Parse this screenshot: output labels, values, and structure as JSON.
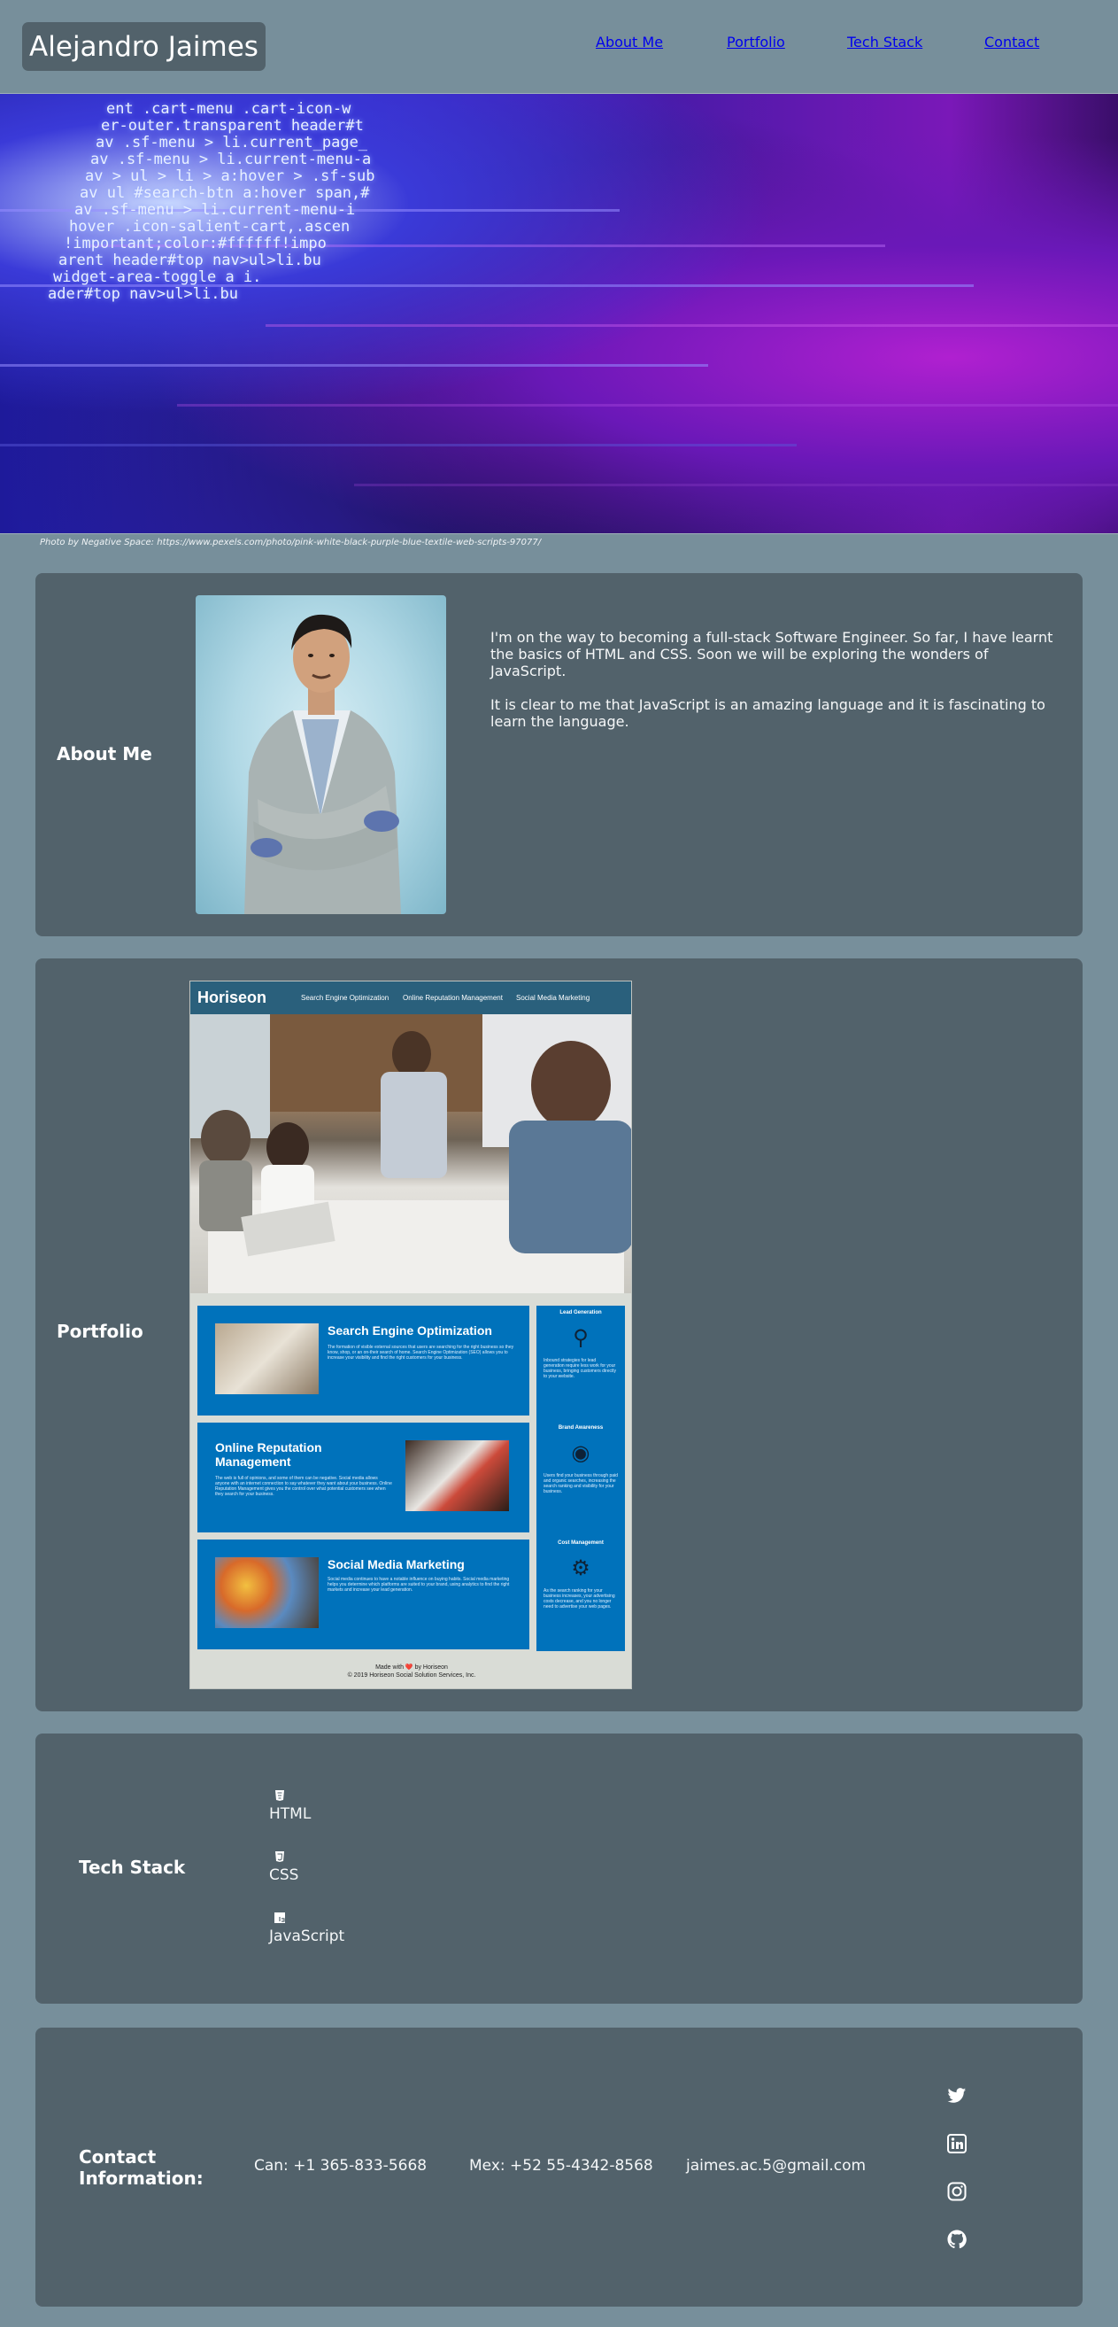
{
  "header": {
    "brand": "Alejandro Jaimes",
    "nav": [
      "About Me",
      "Portfolio",
      "Tech Stack",
      "Contact"
    ]
  },
  "hero": {
    "code_lines": [
      "ent .cart-menu .cart-icon-w",
      "er-outer.transparent header#t",
      "av .sf-menu > li.current_page_",
      "av .sf-menu > li.current-menu-a",
      "av > ul > li > a:hover > .sf-sub",
      "av ul #search-btn a:hover span,#",
      "av .sf-menu > li.current-menu-i",
      "hover .icon-salient-cart,.ascen",
      "!important;color:#ffffff!impo",
      "arent header#top nav>ul>li.bu",
      "widget-area-toggle a i.",
      "ader#top nav>ul>li.bu"
    ],
    "credit": "Photo by Negative Space: https://www.pexels.com/photo/pink-white-black-purple-blue-textile-web-scripts-97077/"
  },
  "about": {
    "title": "About Me",
    "paragraphs": [
      "I'm on the way to becoming a full-stack Software Engineer. So far, I have learnt the basics of HTML and CSS. Soon we will be exploring the wonders of JavaScript.",
      "It is clear to me that JavaScript is an amazing language and it is fascinating to learn the language."
    ]
  },
  "portfolio": {
    "title": "Portfolio",
    "mock": {
      "logo": "Horiseon",
      "nav": [
        "Search Engine Optimization",
        "Online Reputation Management",
        "Social Media Marketing"
      ],
      "boxes": [
        {
          "title": "Search Engine Optimization",
          "text": "The formation of visible external sources that users are searching for the right business so they know, shop, or an on-their search of home. Search Engine Optimization (SEO) allows you to increase your visibility and find the right customers for your business."
        },
        {
          "title": "Online Reputation Management",
          "text": "The web is full of opinions, and some of them can be negative. Social media allows anyone with an internet connection to say whatever they want about your business. Online Reputation Management gives you the control over what potential customers see when they search for your business."
        },
        {
          "title": "Social Media Marketing",
          "text": "Social media continues to have a notable influence on buying habits. Social media marketing helps you determine which platforms are suited to your brand, using analytics to find the right markets and increase your lead generation."
        }
      ],
      "side": [
        {
          "title": "Lead Generation",
          "text": "Inbound strategies for lead generation require less work for your business, bringing customers directly to your website."
        },
        {
          "title": "Brand Awareness",
          "text": "Users find your business through paid and organic searches, increasing the search ranking and visibility for your business."
        },
        {
          "title": "Cost Management",
          "text": "As the search ranking for your business increases, your advertising costs decrease, and you no longer need to advertise your web pages."
        }
      ],
      "footer_made": "Made with ❤️ by Horiseon",
      "footer_copy": "© 2019 Horiseon Social Solution Services, Inc."
    }
  },
  "tech": {
    "title": "Tech Stack",
    "items": [
      {
        "label": "HTML",
        "icon": "html5-icon"
      },
      {
        "label": "CSS",
        "icon": "css3-icon"
      },
      {
        "label": "JavaScript",
        "icon": "js-icon"
      }
    ]
  },
  "contact": {
    "title": "Contact Information:",
    "items": [
      "Can: +1 365-833-5668",
      "Mex: +52 55-4342-8568",
      "jaimes.ac.5@gmail.com"
    ],
    "social": [
      "twitter-icon",
      "linkedin-icon",
      "instagram-icon",
      "github-icon"
    ]
  },
  "colors": {
    "page_bg": "#778f9b",
    "card_bg": "#52626b",
    "mock_blue": "#0072bb",
    "mock_header": "#2a607c"
  }
}
